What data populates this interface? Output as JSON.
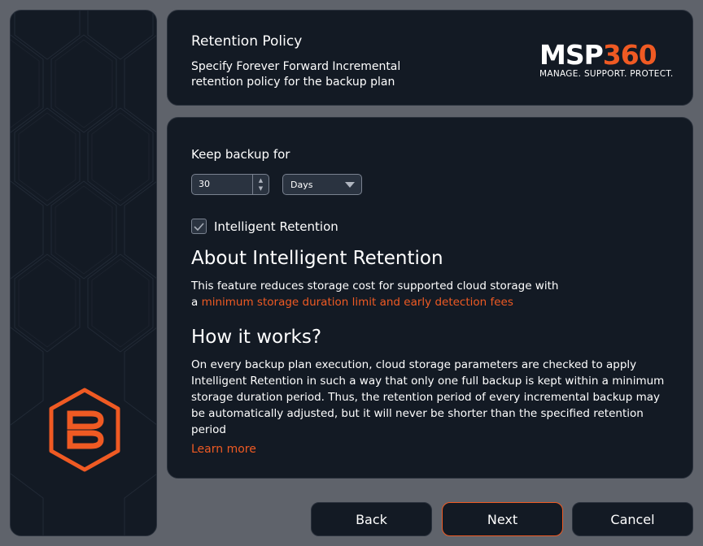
{
  "header": {
    "title": "Retention Policy",
    "subtitle": "Specify Forever Forward Incremental retention policy for the backup plan"
  },
  "brand": {
    "name_part1": "MSP",
    "name_part2": "360",
    "tagline": "MANAGE. SUPPORT. PROTECT.",
    "accent_color": "#ef5a23"
  },
  "form": {
    "keep_label": "Keep backup for",
    "keep_value": "30",
    "unit_selected": "Days",
    "intelligent_retention_label": "Intelligent Retention",
    "intelligent_retention_checked": true
  },
  "about": {
    "heading": "About Intelligent Retention",
    "text_before_link": "This feature reduces storage cost for supported cloud storage with a ",
    "link_text": "minimum storage duration limit and early detection fees"
  },
  "how": {
    "heading": "How it works?",
    "text": "On every backup plan execution, cloud storage parameters are checked to apply Intelligent Retention in such a way that only one full backup is kept within a minimum storage duration period. Thus, the retention period of every incremental backup may be automatically adjusted, but it will never be shorter than the specified retention period",
    "learn_more": "Learn more"
  },
  "buttons": {
    "back": "Back",
    "next": "Next",
    "cancel": "Cancel"
  },
  "icons": {
    "spin_up": "▲",
    "spin_down": "▼",
    "checkbox": "checkmark-icon",
    "side_logo": "backup-b-logo-icon"
  }
}
